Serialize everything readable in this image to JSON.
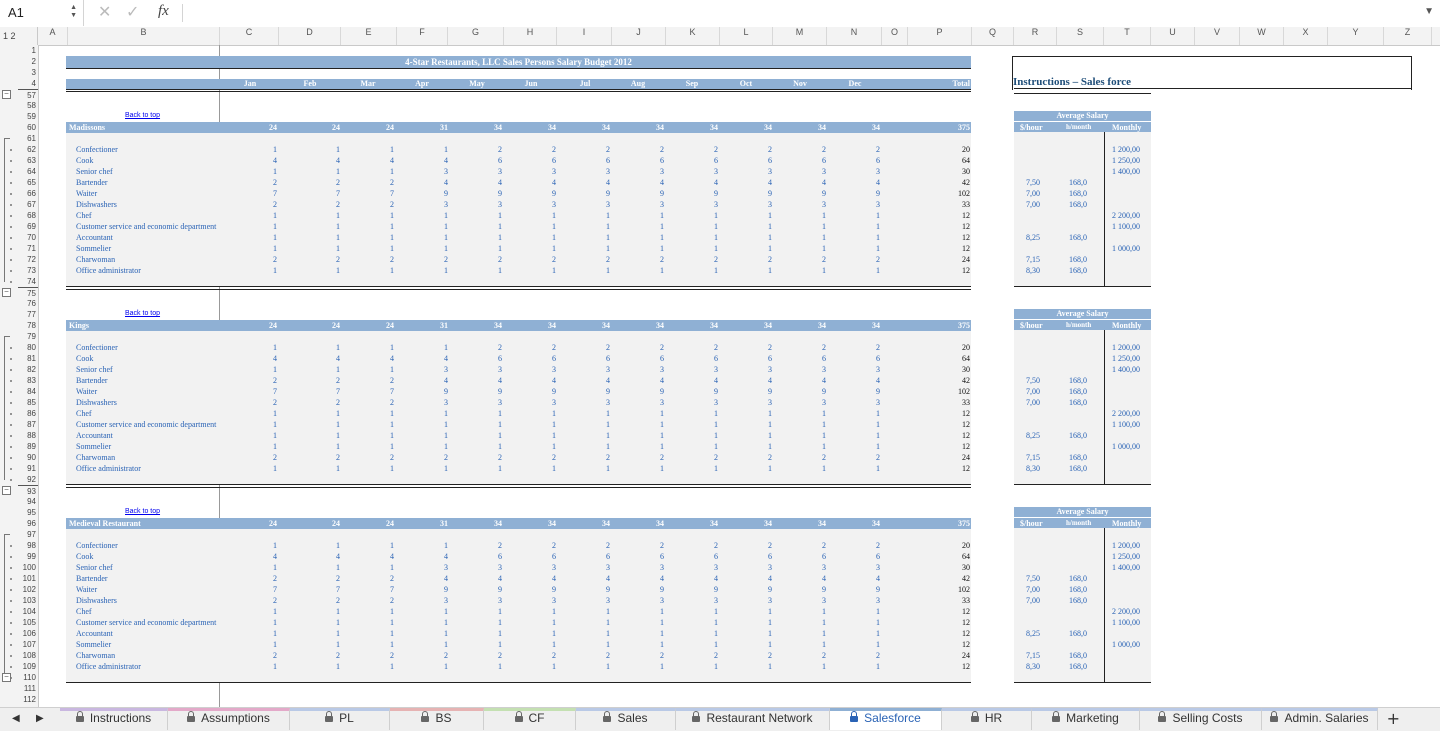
{
  "formula_bar": {
    "cell_ref": "A1",
    "fx_label": "fx",
    "cancel_icon": "close-icon",
    "enter_icon": "check-icon",
    "value": ""
  },
  "outline_levels": "1 2",
  "columns": [
    "A",
    "B",
    "C",
    "D",
    "E",
    "F",
    "G",
    "H",
    "I",
    "J",
    "K",
    "L",
    "M",
    "N",
    "O",
    "P",
    "Q",
    "R",
    "S",
    "T",
    "U",
    "V",
    "W",
    "X",
    "Y",
    "Z"
  ],
  "sheet_title": "4-Star Restaurants, LLC Sales Persons Salary Budget 2012",
  "months": [
    "Jan",
    "Feb",
    "Mar",
    "Apr",
    "May",
    "Jun",
    "Jul",
    "Aug",
    "Sep",
    "Oct",
    "Nov",
    "Dec"
  ],
  "total_label": "Total",
  "instructions_title": "Instructions – Sales force",
  "back_to_top": "Back to top",
  "avg_salary": {
    "title": "Average Salary",
    "col1": "$/hour",
    "col2": "h/month",
    "col3": "Monthly"
  },
  "positions": [
    "Confectioner",
    "Cook",
    "Senior chef",
    "Bartender",
    "Waiter",
    "Dishwashers",
    "Chef",
    "Customer service and economic department",
    "Accountant",
    "Sommelier",
    "Charwoman",
    "Office administrator"
  ],
  "rates": [
    {
      "hour": "",
      "hmonth": "",
      "monthly": "1 200,00"
    },
    {
      "hour": "",
      "hmonth": "",
      "monthly": "1 250,00"
    },
    {
      "hour": "",
      "hmonth": "",
      "monthly": "1 400,00"
    },
    {
      "hour": "7,50",
      "hmonth": "168,0",
      "monthly": ""
    },
    {
      "hour": "7,00",
      "hmonth": "168,0",
      "monthly": ""
    },
    {
      "hour": "7,00",
      "hmonth": "168,0",
      "monthly": ""
    },
    {
      "hour": "",
      "hmonth": "",
      "monthly": "2 200,00"
    },
    {
      "hour": "",
      "hmonth": "",
      "monthly": "1 100,00"
    },
    {
      "hour": "8,25",
      "hmonth": "168,0",
      "monthly": ""
    },
    {
      "hour": "",
      "hmonth": "",
      "monthly": "1 000,00"
    },
    {
      "hour": "7,15",
      "hmonth": "168,0",
      "monthly": ""
    },
    {
      "hour": "8,30",
      "hmonth": "168,0",
      "monthly": ""
    }
  ],
  "sections": [
    {
      "name": "Madissons",
      "header_row": 60,
      "first_row": 57,
      "header_values": [
        "24",
        "24",
        "24",
        "31",
        "34",
        "34",
        "34",
        "34",
        "34",
        "34",
        "34",
        "34"
      ],
      "header_total": "375",
      "rows": [
        {
          "values": [
            "1",
            "1",
            "1",
            "1",
            "2",
            "2",
            "2",
            "2",
            "2",
            "2",
            "2",
            "2"
          ],
          "total": "20"
        },
        {
          "values": [
            "4",
            "4",
            "4",
            "4",
            "6",
            "6",
            "6",
            "6",
            "6",
            "6",
            "6",
            "6"
          ],
          "total": "64"
        },
        {
          "values": [
            "1",
            "1",
            "1",
            "3",
            "3",
            "3",
            "3",
            "3",
            "3",
            "3",
            "3",
            "3"
          ],
          "total": "30"
        },
        {
          "values": [
            "2",
            "2",
            "2",
            "4",
            "4",
            "4",
            "4",
            "4",
            "4",
            "4",
            "4",
            "4"
          ],
          "total": "42"
        },
        {
          "values": [
            "7",
            "7",
            "7",
            "9",
            "9",
            "9",
            "9",
            "9",
            "9",
            "9",
            "9",
            "9"
          ],
          "total": "102"
        },
        {
          "values": [
            "2",
            "2",
            "2",
            "3",
            "3",
            "3",
            "3",
            "3",
            "3",
            "3",
            "3",
            "3"
          ],
          "total": "33"
        },
        {
          "values": [
            "1",
            "1",
            "1",
            "1",
            "1",
            "1",
            "1",
            "1",
            "1",
            "1",
            "1",
            "1"
          ],
          "total": "12"
        },
        {
          "values": [
            "1",
            "1",
            "1",
            "1",
            "1",
            "1",
            "1",
            "1",
            "1",
            "1",
            "1",
            "1"
          ],
          "total": "12"
        },
        {
          "values": [
            "1",
            "1",
            "1",
            "1",
            "1",
            "1",
            "1",
            "1",
            "1",
            "1",
            "1",
            "1"
          ],
          "total": "12"
        },
        {
          "values": [
            "1",
            "1",
            "1",
            "1",
            "1",
            "1",
            "1",
            "1",
            "1",
            "1",
            "1",
            "1"
          ],
          "total": "12"
        },
        {
          "values": [
            "2",
            "2",
            "2",
            "2",
            "2",
            "2",
            "2",
            "2",
            "2",
            "2",
            "2",
            "2"
          ],
          "total": "24"
        },
        {
          "values": [
            "1",
            "1",
            "1",
            "1",
            "1",
            "1",
            "1",
            "1",
            "1",
            "1",
            "1",
            "1"
          ],
          "total": "12"
        }
      ]
    },
    {
      "name": "Kings",
      "header_row": 78,
      "first_row": 75,
      "header_values": [
        "24",
        "24",
        "24",
        "31",
        "34",
        "34",
        "34",
        "34",
        "34",
        "34",
        "34",
        "34"
      ],
      "header_total": "375",
      "rows": [
        {
          "values": [
            "1",
            "1",
            "1",
            "1",
            "2",
            "2",
            "2",
            "2",
            "2",
            "2",
            "2",
            "2"
          ],
          "total": "20"
        },
        {
          "values": [
            "4",
            "4",
            "4",
            "4",
            "6",
            "6",
            "6",
            "6",
            "6",
            "6",
            "6",
            "6"
          ],
          "total": "64"
        },
        {
          "values": [
            "1",
            "1",
            "1",
            "3",
            "3",
            "3",
            "3",
            "3",
            "3",
            "3",
            "3",
            "3"
          ],
          "total": "30"
        },
        {
          "values": [
            "2",
            "2",
            "2",
            "4",
            "4",
            "4",
            "4",
            "4",
            "4",
            "4",
            "4",
            "4"
          ],
          "total": "42"
        },
        {
          "values": [
            "7",
            "7",
            "7",
            "9",
            "9",
            "9",
            "9",
            "9",
            "9",
            "9",
            "9",
            "9"
          ],
          "total": "102"
        },
        {
          "values": [
            "2",
            "2",
            "2",
            "3",
            "3",
            "3",
            "3",
            "3",
            "3",
            "3",
            "3",
            "3"
          ],
          "total": "33"
        },
        {
          "values": [
            "1",
            "1",
            "1",
            "1",
            "1",
            "1",
            "1",
            "1",
            "1",
            "1",
            "1",
            "1"
          ],
          "total": "12"
        },
        {
          "values": [
            "1",
            "1",
            "1",
            "1",
            "1",
            "1",
            "1",
            "1",
            "1",
            "1",
            "1",
            "1"
          ],
          "total": "12"
        },
        {
          "values": [
            "1",
            "1",
            "1",
            "1",
            "1",
            "1",
            "1",
            "1",
            "1",
            "1",
            "1",
            "1"
          ],
          "total": "12"
        },
        {
          "values": [
            "1",
            "1",
            "1",
            "1",
            "1",
            "1",
            "1",
            "1",
            "1",
            "1",
            "1",
            "1"
          ],
          "total": "12"
        },
        {
          "values": [
            "2",
            "2",
            "2",
            "2",
            "2",
            "2",
            "2",
            "2",
            "2",
            "2",
            "2",
            "2"
          ],
          "total": "24"
        },
        {
          "values": [
            "1",
            "1",
            "1",
            "1",
            "1",
            "1",
            "1",
            "1",
            "1",
            "1",
            "1",
            "1"
          ],
          "total": "12"
        }
      ]
    },
    {
      "name": "Medieval Restaurant",
      "header_row": 96,
      "first_row": 93,
      "header_values": [
        "24",
        "24",
        "24",
        "31",
        "34",
        "34",
        "34",
        "34",
        "34",
        "34",
        "34",
        "34"
      ],
      "header_total": "375",
      "rows": [
        {
          "values": [
            "1",
            "1",
            "1",
            "1",
            "2",
            "2",
            "2",
            "2",
            "2",
            "2",
            "2",
            "2"
          ],
          "total": "20"
        },
        {
          "values": [
            "4",
            "4",
            "4",
            "4",
            "6",
            "6",
            "6",
            "6",
            "6",
            "6",
            "6",
            "6"
          ],
          "total": "64"
        },
        {
          "values": [
            "1",
            "1",
            "1",
            "3",
            "3",
            "3",
            "3",
            "3",
            "3",
            "3",
            "3",
            "3"
          ],
          "total": "30"
        },
        {
          "values": [
            "2",
            "2",
            "2",
            "4",
            "4",
            "4",
            "4",
            "4",
            "4",
            "4",
            "4",
            "4"
          ],
          "total": "42"
        },
        {
          "values": [
            "7",
            "7",
            "7",
            "9",
            "9",
            "9",
            "9",
            "9",
            "9",
            "9",
            "9",
            "9"
          ],
          "total": "102"
        },
        {
          "values": [
            "2",
            "2",
            "2",
            "3",
            "3",
            "3",
            "3",
            "3",
            "3",
            "3",
            "3",
            "3"
          ],
          "total": "33"
        },
        {
          "values": [
            "1",
            "1",
            "1",
            "1",
            "1",
            "1",
            "1",
            "1",
            "1",
            "1",
            "1",
            "1"
          ],
          "total": "12"
        },
        {
          "values": [
            "1",
            "1",
            "1",
            "1",
            "1",
            "1",
            "1",
            "1",
            "1",
            "1",
            "1",
            "1"
          ],
          "total": "12"
        },
        {
          "values": [
            "1",
            "1",
            "1",
            "1",
            "1",
            "1",
            "1",
            "1",
            "1",
            "1",
            "1",
            "1"
          ],
          "total": "12"
        },
        {
          "values": [
            "1",
            "1",
            "1",
            "1",
            "1",
            "1",
            "1",
            "1",
            "1",
            "1",
            "1",
            "1"
          ],
          "total": "12"
        },
        {
          "values": [
            "2",
            "2",
            "2",
            "2",
            "2",
            "2",
            "2",
            "2",
            "2",
            "2",
            "2",
            "2"
          ],
          "total": "24"
        },
        {
          "values": [
            "1",
            "1",
            "1",
            "1",
            "1",
            "1",
            "1",
            "1",
            "1",
            "1",
            "1",
            "1"
          ],
          "total": "12"
        }
      ]
    }
  ],
  "tabs": [
    {
      "label": "Instructions",
      "locked": true,
      "active": false,
      "accent": "#c9b7e0"
    },
    {
      "label": "Assumptions",
      "locked": true,
      "active": false,
      "accent": "#e3a9c9"
    },
    {
      "label": "PL",
      "locked": true,
      "active": false,
      "accent": "#b9c9e6"
    },
    {
      "label": "BS",
      "locked": true,
      "active": false,
      "accent": "#e6b3b3"
    },
    {
      "label": "CF",
      "locked": true,
      "active": false,
      "accent": "#c4e0b2"
    },
    {
      "label": "Sales",
      "locked": true,
      "active": false,
      "accent": "#b9c9e6"
    },
    {
      "label": "Restaurant Network",
      "locked": true,
      "active": false,
      "accent": "#b9c9e6"
    },
    {
      "label": "Salesforce",
      "locked": true,
      "active": true,
      "accent": "#8fb0d4"
    },
    {
      "label": "HR",
      "locked": true,
      "active": false,
      "accent": "#b9c9e6"
    },
    {
      "label": "Marketing",
      "locked": true,
      "active": false,
      "accent": "#b9c9e6"
    },
    {
      "label": "Selling Costs",
      "locked": true,
      "active": false,
      "accent": "#b9c9e6"
    },
    {
      "label": "Admin. Salaries",
      "locked": true,
      "active": false,
      "accent": "#b9c9e6"
    }
  ],
  "add_sheet_label": "+"
}
